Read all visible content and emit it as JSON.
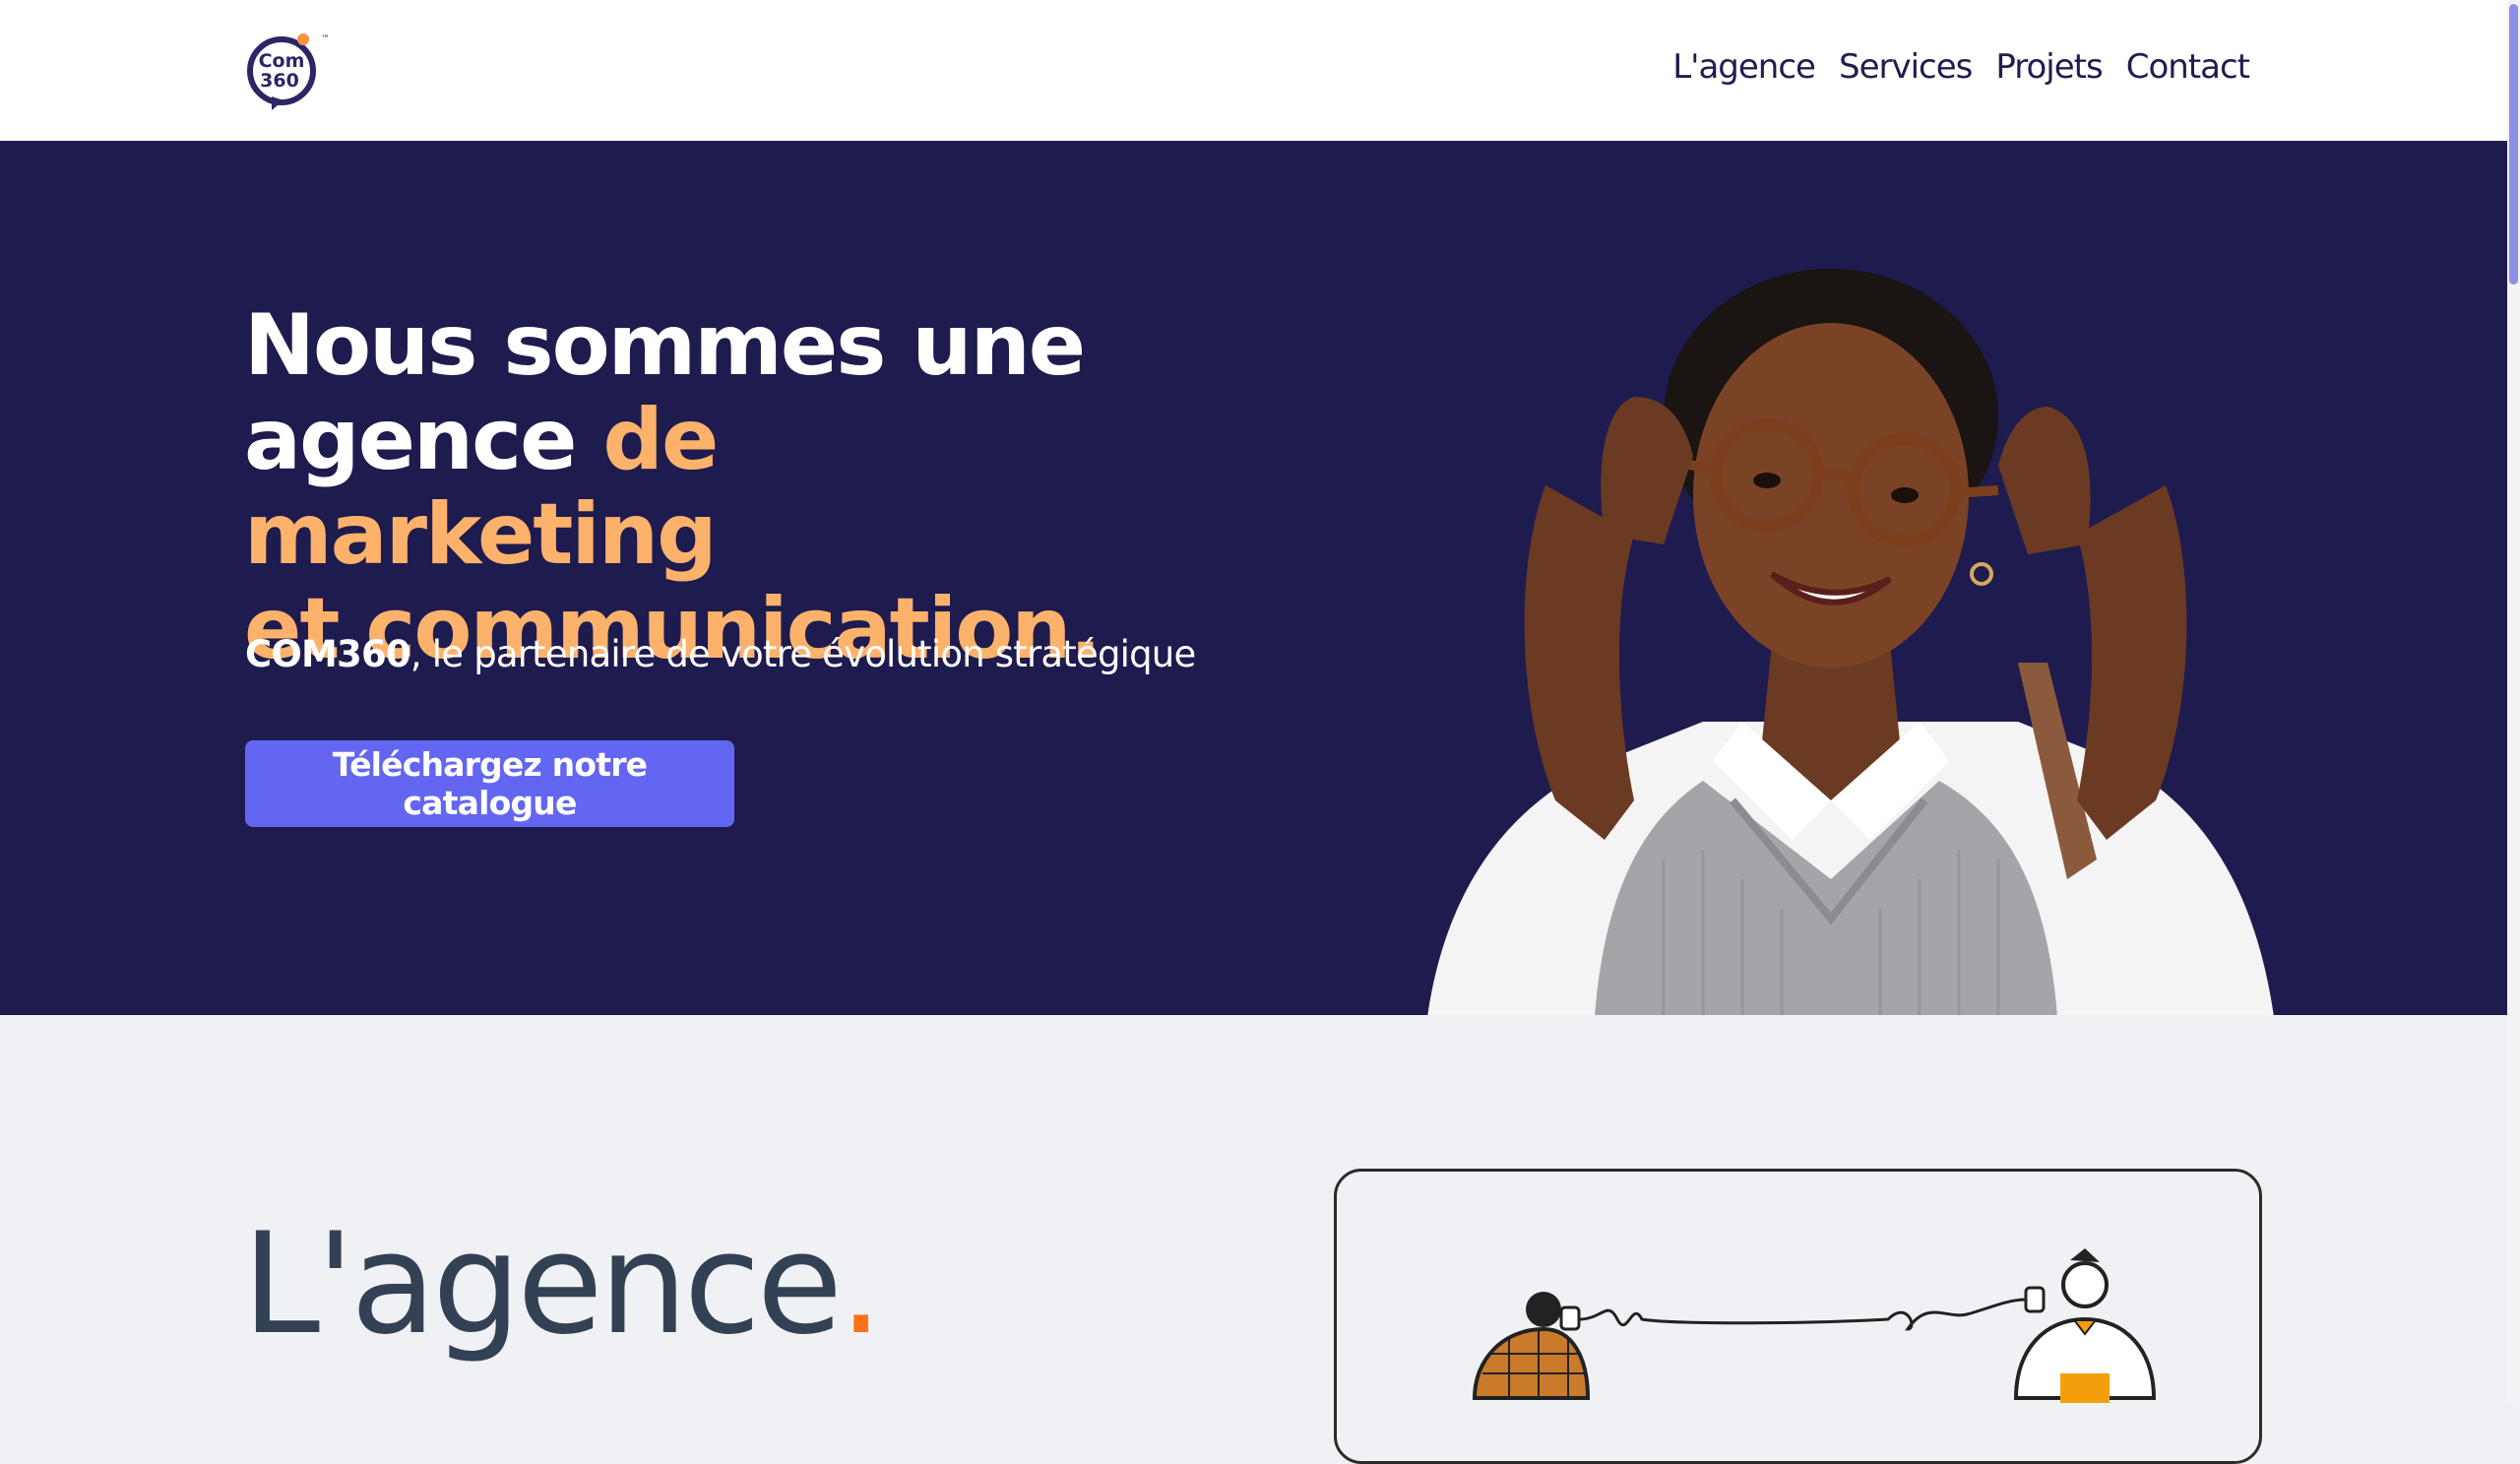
{
  "header": {
    "logo_text_top": "Com",
    "logo_text_bottom": "360",
    "logo_tm": "™",
    "nav": [
      {
        "label": "L'agence"
      },
      {
        "label": "Services"
      },
      {
        "label": "Projets"
      },
      {
        "label": "Contact"
      }
    ]
  },
  "hero": {
    "title_line1": "Nous sommes une",
    "title_line2_plain": "agence ",
    "title_line2_accent": "de marketing",
    "title_line3_accent": "et communication.",
    "subtitle_brand": "COM360",
    "subtitle_rest": ", le partenaire de votre évolution stratégique",
    "cta_label": "Téléchargez notre catalogue"
  },
  "section_agence": {
    "title": "L'agence",
    "title_dot": "."
  },
  "colors": {
    "hero_bg": "#1e1b4f",
    "accent_orange": "#fdb26b",
    "cta_bg": "#6366f1",
    "nav_text": "#1f1d4f",
    "section_bg": "#f0f1f4",
    "title_dot": "#f97316"
  },
  "icons": [
    "com360-logo-icon",
    "woman-glasses-photo",
    "tin-can-phone-illustration"
  ]
}
